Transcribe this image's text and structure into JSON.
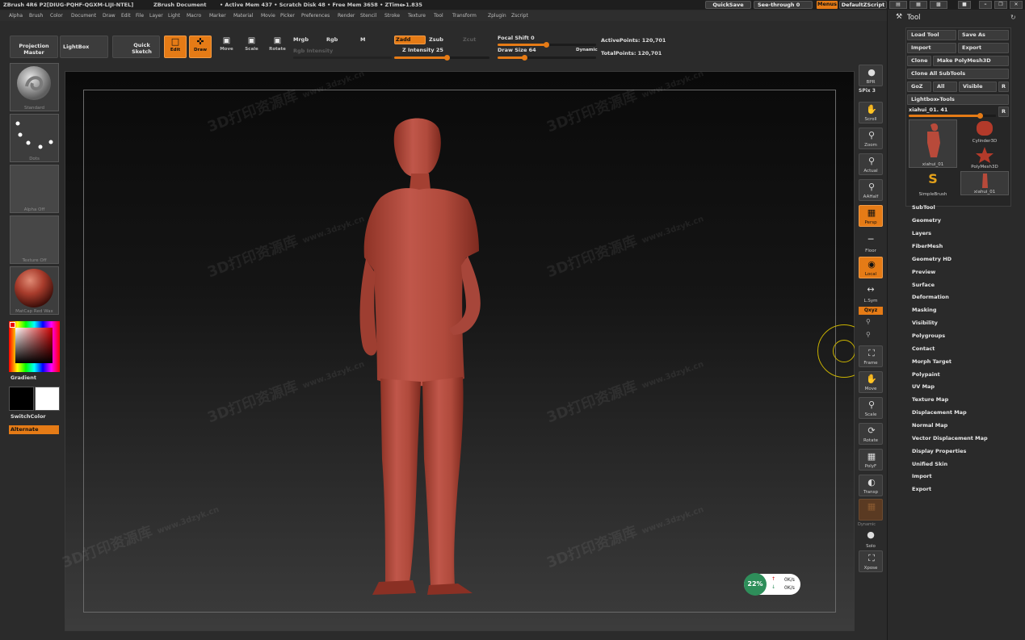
{
  "title_bar": {
    "app": "ZBrush 4R6 P2[DIUG-PQHF-QGXM-LIJI-NTEL]",
    "doc": "ZBrush Document",
    "stats": "• Active Mem 437 • Scratch Disk 48 • Free Mem 3658 • ZTime▸1.835",
    "quicksave": "QuickSave",
    "see_through": "See-through  0",
    "menus": "Menus",
    "script": "DefaultZScript"
  },
  "menubar": [
    "Alpha",
    "Brush",
    "Color",
    "Document",
    "Draw",
    "Edit",
    "File",
    "Layer",
    "Light",
    "Macro",
    "Marker",
    "Material",
    "Movie",
    "Picker",
    "Preferences",
    "Render",
    "Stencil",
    "Stroke",
    "Texture",
    "Tool",
    "Transform",
    "Zplugin",
    "Zscript"
  ],
  "toolbar": {
    "projection_master": "Projection Master",
    "lightbox": "LightBox",
    "quick_sketch": "Quick Sketch",
    "edit": "Edit",
    "draw": "Draw",
    "move": "Move",
    "scale": "Scale",
    "rotate": "Rotate",
    "mrgb": "Mrgb",
    "rgb": "Rgb",
    "m": "M",
    "rgb_intensity": "Rgb Intensity",
    "zadd": "Zadd",
    "zsub": "Zsub",
    "zcut": "Zcut",
    "z_intensity": "Z Intensity 25",
    "focal_shift": "Focal Shift 0",
    "draw_size": "Draw Size 64",
    "dynamic": "Dynamic",
    "active_points": "ActivePoints: 120,701",
    "total_points": "TotalPoints: 120,701",
    "z_intensity_value": 25,
    "z_intensity_max": 100,
    "focal_shift_value": 0,
    "draw_size_value": 64
  },
  "left_shelf": {
    "brush": "Standard",
    "stroke": "Dots",
    "alpha": "Alpha Off",
    "texture": "Texture Off",
    "material": "MatCap Red Wax",
    "gradient": "Gradient",
    "switch_color": "SwitchColor",
    "alternate": "Alternate"
  },
  "right_tools": {
    "bpr": "BPR",
    "spix": "SPix 3",
    "scroll": "Scroll",
    "zoom": "Zoom",
    "actual": "Actual",
    "aahalf": "AAHalf",
    "persp": "Persp",
    "floor": "Floor",
    "local": "Local",
    "lsym": "L.Sym",
    "xyz": "Qxyz",
    "frame": "Frame",
    "move": "Move",
    "scale": "Scale",
    "rotate": "Rotate",
    "polyf": "PolyF",
    "transp": "Transp",
    "dynamic": "Dynamic",
    "solo": "Solo",
    "xpose": "Xpose"
  },
  "tool_panel": {
    "title": "Tool",
    "load_tool": "Load Tool",
    "save_as": "Save As",
    "import": "Import",
    "export": "Export",
    "clone": "Clone",
    "make_polymesh": "Make PolyMesh3D",
    "clone_all": "Clone All SubTools",
    "goz": "GoZ",
    "all": "All",
    "visible": "Visible",
    "r": "R",
    "lightbox_tools": "Lightbox▸Tools",
    "current_tool": "xiahui_01. 41",
    "tools": [
      {
        "name": "xiahui_01"
      },
      {
        "name": "Cylinder3D"
      },
      {
        "name": "PolyMesh3D"
      },
      {
        "name": "SimpleBrush"
      },
      {
        "name": "xiahui_01"
      }
    ],
    "sections": [
      "SubTool",
      "Geometry",
      "Layers",
      "FiberMesh",
      "Geometry HD",
      "Preview",
      "Surface",
      "Deformation",
      "Masking",
      "Visibility",
      "Polygroups",
      "Contact",
      "Morph Target",
      "Polypaint",
      "UV Map",
      "Texture Map",
      "Displacement Map",
      "Normal Map",
      "Vector Displacement Map",
      "Display Properties",
      "Unified Skin",
      "Import",
      "Export"
    ]
  },
  "net_widget": {
    "percent": "22%",
    "up": "0K/s",
    "down": "0K/s"
  },
  "watermark": {
    "title": "3D打印资源库",
    "url": "www.3dzyk.cn"
  },
  "colors": {
    "accent": "#e57b16",
    "model": "#b84a3a",
    "panel": "#2b2b2b"
  }
}
